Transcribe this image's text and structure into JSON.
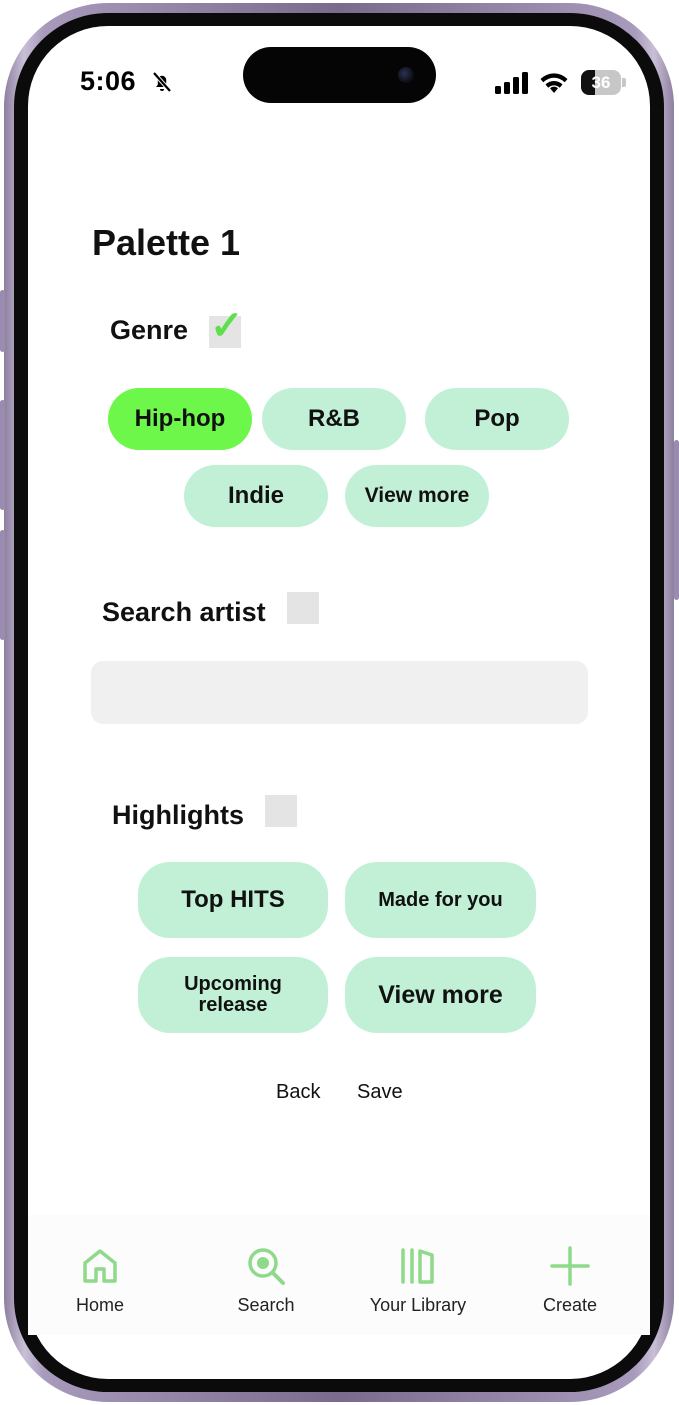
{
  "status_bar": {
    "time": "5:06",
    "battery": "36",
    "battery_level": 0.36
  },
  "page": {
    "title": "Palette 1"
  },
  "genre": {
    "label": "Genre",
    "checked": true,
    "chips": [
      {
        "label": "Hip-hop",
        "active": true
      },
      {
        "label": "R&B",
        "active": false
      },
      {
        "label": "Pop",
        "active": false
      },
      {
        "label": "Indie",
        "active": false
      },
      {
        "label": "View more",
        "active": false
      }
    ]
  },
  "search_artist": {
    "label": "Search artist",
    "checked": false,
    "value": "",
    "placeholder": ""
  },
  "highlights": {
    "label": "Highlights",
    "checked": false,
    "chips": [
      {
        "label": "Top HITS"
      },
      {
        "label": "Made for you"
      },
      {
        "label": "Upcoming release"
      },
      {
        "label": "View more"
      }
    ]
  },
  "actions": {
    "back": "Back",
    "save": "Save"
  },
  "tabbar": {
    "accent_color": "#8fd98a",
    "items": [
      {
        "label": "Home",
        "icon": "home-icon"
      },
      {
        "label": "Search",
        "icon": "search-icon"
      },
      {
        "label": "Your Library",
        "icon": "library-icon"
      },
      {
        "label": "Create",
        "icon": "plus-icon"
      }
    ]
  },
  "colors": {
    "chip": "#c2f0d6",
    "chip_active": "#6cf74a",
    "check": "#5ee04e"
  }
}
